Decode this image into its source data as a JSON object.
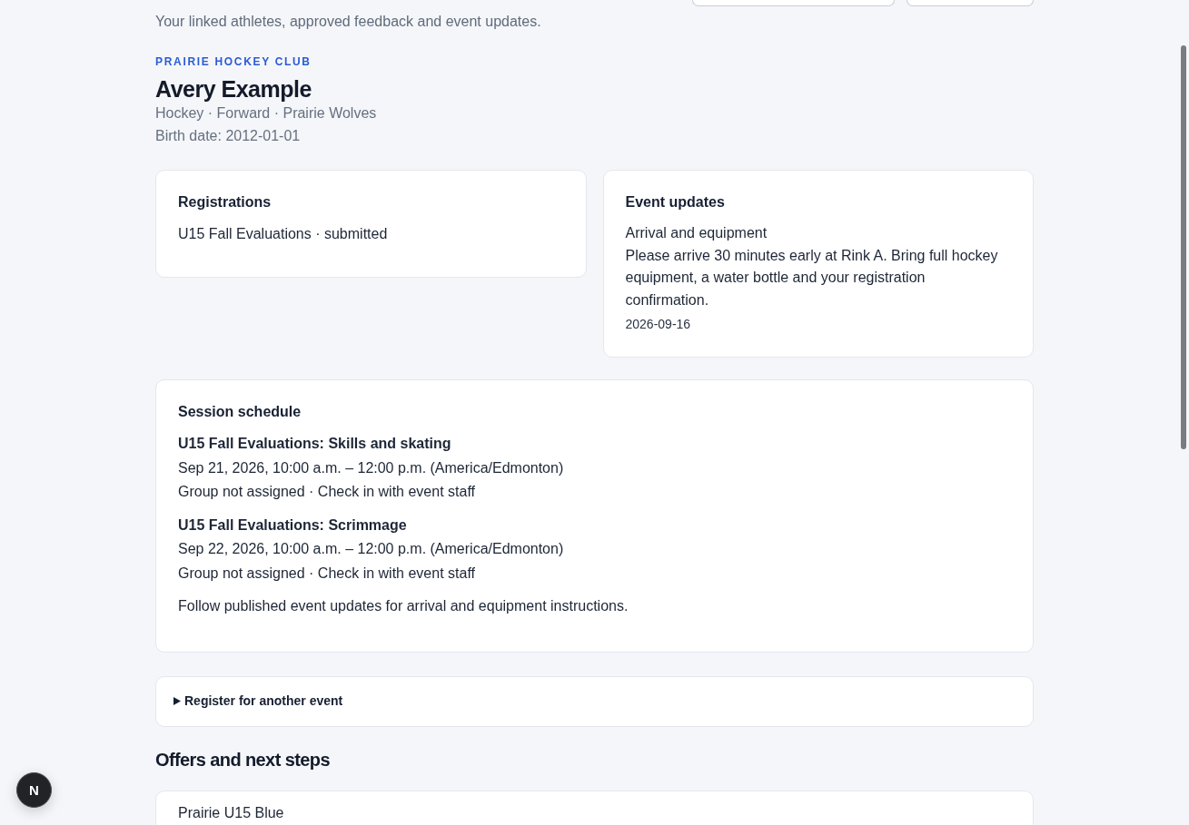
{
  "header": {
    "subtitle": "Your linked athletes, approved feedback and event updates.",
    "buttons": [
      {
        "kind": "outline"
      },
      {
        "kind": "outline"
      }
    ]
  },
  "athlete": {
    "club": "PRAIRIE HOCKEY CLUB",
    "name": "Avery Example",
    "details": "Hockey · Forward · Prairie Wolves",
    "birth_date": "Birth date: 2012-01-01"
  },
  "registrations": {
    "title": "Registrations",
    "items": [
      "U15 Fall Evaluations · submitted"
    ]
  },
  "event_updates": {
    "title": "Event updates",
    "items": [
      {
        "title": "Arrival and equipment",
        "body": "Please arrive 30 minutes early at Rink A. Bring full hockey equipment, a water bottle and your registration confirmation.",
        "date": "2026-09-16"
      }
    ]
  },
  "session_schedule": {
    "title": "Session schedule",
    "sessions": [
      {
        "title": "U15 Fall Evaluations: Skills and skating",
        "time": "Sep 21, 2026, 10:00 a.m. – 12:00 p.m. (America/Edmonton)",
        "group": "Group not assigned · Check in with event staff"
      },
      {
        "title": "U15 Fall Evaluations: Scrimmage",
        "time": "Sep 22, 2026, 10:00 a.m. – 12:00 p.m. (America/Edmonton)",
        "group": "Group not assigned · Check in with event staff"
      }
    ],
    "note": "Follow published event updates for arrival and equipment instructions."
  },
  "register_another": {
    "label": "Register for another event",
    "expanded": false
  },
  "offers": {
    "title": "Offers and next steps",
    "items": [
      {
        "title": "Prairie U15 Blue"
      }
    ]
  },
  "dev_tools": {
    "label": "N"
  }
}
